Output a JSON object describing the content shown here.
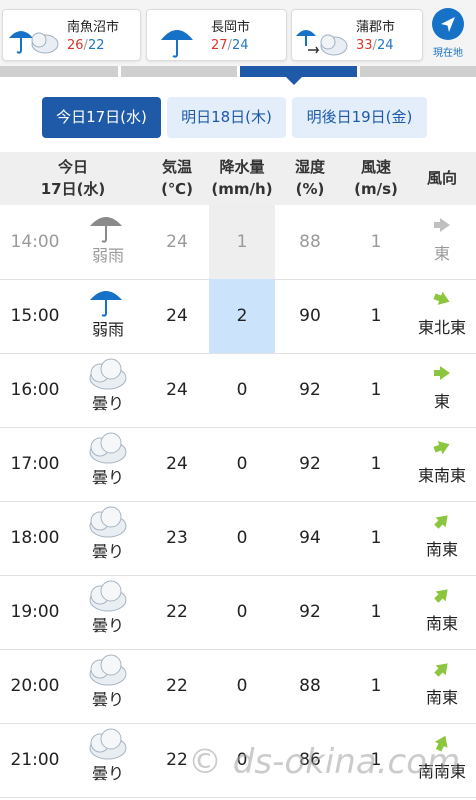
{
  "cities": [
    {
      "name": "南魚沼市",
      "high": "26",
      "low": "22",
      "icon": "rain-cloud-icon"
    },
    {
      "name": "長岡市",
      "high": "27",
      "low": "24",
      "icon": "umbrella-icon"
    },
    {
      "name": "蒲郡市",
      "high": "33",
      "low": "24",
      "icon": "rain-to-cloud-icon"
    }
  ],
  "temp_separator": "/",
  "location_button": {
    "label": "現在地",
    "icon": "location-arrow-icon"
  },
  "day_tabs": [
    {
      "label": "今日17日(水)",
      "active": true
    },
    {
      "label": "明日18日(木)",
      "active": false
    },
    {
      "label": "明後日19日(金)",
      "active": false
    }
  ],
  "table_header": {
    "date_line1": "今日",
    "date_line2": "17日(水)",
    "temp_line1": "気温",
    "temp_line2": "(℃)",
    "rain_line1": "降水量",
    "rain_line2": "(mm/h)",
    "hum_line1": "湿度",
    "hum_line2": "(%)",
    "wind_line1": "風速",
    "wind_line2": "(m/s)",
    "dir_label": "風向"
  },
  "rows": [
    {
      "time": "14:00",
      "weather": "弱雨",
      "icon": "umbrella-icon",
      "temp": "24",
      "rain": "1",
      "humidity": "88",
      "wind": "1",
      "direction": "東",
      "past": true
    },
    {
      "time": "15:00",
      "weather": "弱雨",
      "icon": "umbrella-icon",
      "temp": "24",
      "rain": "2",
      "humidity": "90",
      "wind": "1",
      "direction": "東北東",
      "past": false
    },
    {
      "time": "16:00",
      "weather": "曇り",
      "icon": "cloud-icon",
      "temp": "24",
      "rain": "0",
      "humidity": "92",
      "wind": "1",
      "direction": "東",
      "past": false
    },
    {
      "time": "17:00",
      "weather": "曇り",
      "icon": "cloud-icon",
      "temp": "24",
      "rain": "0",
      "humidity": "92",
      "wind": "1",
      "direction": "東南東",
      "past": false
    },
    {
      "time": "18:00",
      "weather": "曇り",
      "icon": "cloud-icon",
      "temp": "23",
      "rain": "0",
      "humidity": "94",
      "wind": "1",
      "direction": "南東",
      "past": false
    },
    {
      "time": "19:00",
      "weather": "曇り",
      "icon": "cloud-icon",
      "temp": "22",
      "rain": "0",
      "humidity": "92",
      "wind": "1",
      "direction": "南東",
      "past": false
    },
    {
      "time": "20:00",
      "weather": "曇り",
      "icon": "cloud-icon",
      "temp": "22",
      "rain": "0",
      "humidity": "88",
      "wind": "1",
      "direction": "南東",
      "past": false
    },
    {
      "time": "21:00",
      "weather": "曇り",
      "icon": "cloud-icon",
      "temp": "22",
      "rain": "0",
      "humidity": "86",
      "wind": "1",
      "direction": "南南東",
      "past": false
    }
  ],
  "watermark": "© ds-okina.com",
  "colors": {
    "accent": "#1e5aa8",
    "high": "#d8362c",
    "low": "#1f77c9",
    "wind_arrow": "#8cc63f",
    "rain_highlight": "#cbe3fb"
  }
}
